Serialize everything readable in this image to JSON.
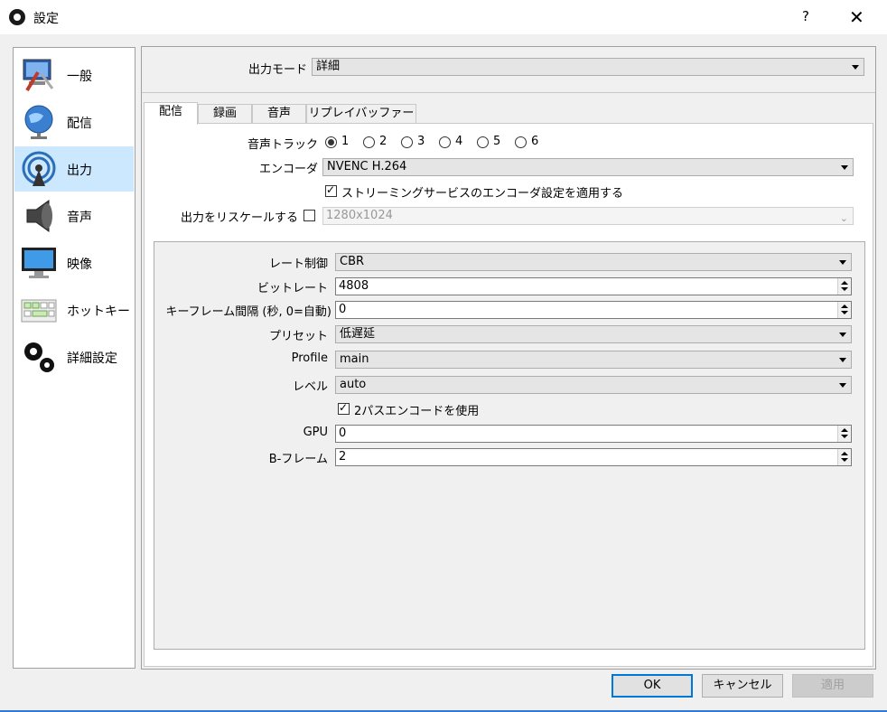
{
  "window": {
    "title": "設定",
    "help": "?",
    "close": "✕"
  },
  "sidebar": {
    "items": [
      {
        "label": "一般",
        "icon": "general-settings-icon"
      },
      {
        "label": "配信",
        "icon": "stream-globe-icon"
      },
      {
        "label": "出力",
        "icon": "output-broadcast-icon",
        "selected": true
      },
      {
        "label": "音声",
        "icon": "speaker-icon"
      },
      {
        "label": "映像",
        "icon": "monitor-icon"
      },
      {
        "label": "ホットキー",
        "icon": "keyboard-icon"
      },
      {
        "label": "詳細設定",
        "icon": "gears-icon"
      }
    ]
  },
  "output": {
    "mode_label": "出力モード",
    "mode_value": "詳細",
    "tabs": [
      "配信",
      "録画",
      "音声",
      "リプレイバッファー"
    ],
    "audio_track_label": "音声トラック",
    "audio_tracks": [
      "1",
      "2",
      "3",
      "4",
      "5",
      "6"
    ],
    "audio_track_selected": "1",
    "encoder_label": "エンコーダ",
    "encoder_value": "NVENC H.264",
    "enforce_label": "ストリーミングサービスのエンコーダ設定を適用する",
    "rescale_label": "出力をリスケールする",
    "rescale_value": "1280x1024",
    "rate_control_label": "レート制御",
    "rate_control_value": "CBR",
    "bitrate_label": "ビットレート",
    "bitrate_value": "4808",
    "keyframe_label": "キーフレーム間隔 (秒, 0=自動)",
    "keyframe_value": "0",
    "preset_label": "プリセット",
    "preset_value": "低遅延",
    "profile_label": "Profile",
    "profile_value": "main",
    "level_label": "レベル",
    "level_value": "auto",
    "twopass_label": "2パスエンコードを使用",
    "gpu_label": "GPU",
    "gpu_value": "0",
    "bframes_label": "B-フレーム",
    "bframes_value": "2"
  },
  "buttons": {
    "ok": "OK",
    "cancel": "キャンセル",
    "apply": "適用"
  }
}
